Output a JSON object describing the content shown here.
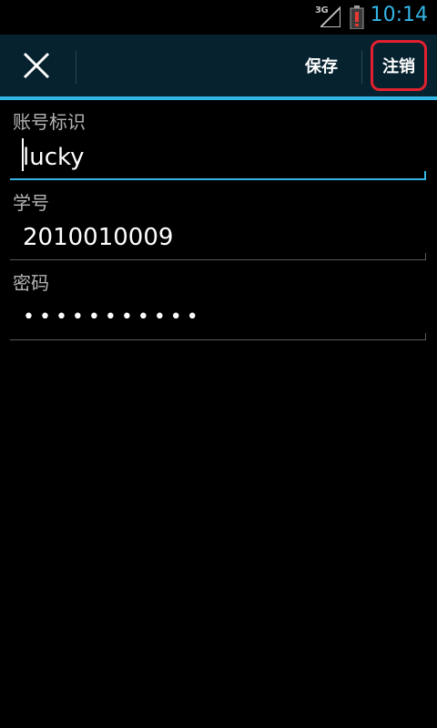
{
  "status_bar": {
    "network": "3G",
    "time": "10:14",
    "icons": [
      "signal-icon",
      "battery-alert-icon"
    ]
  },
  "action_bar": {
    "close_icon": "close-icon",
    "save_label": "保存",
    "logout_label": "注销"
  },
  "form": {
    "account_label": "账号标识",
    "account_value": "lucky",
    "student_id_label": "学号",
    "student_id_value": "2010010009",
    "password_label": "密码",
    "password_value": "•••••••••••"
  },
  "colors": {
    "accent": "#33b5e5",
    "action_bar_bg": "#06222f",
    "highlight_box": "#e2202f"
  }
}
